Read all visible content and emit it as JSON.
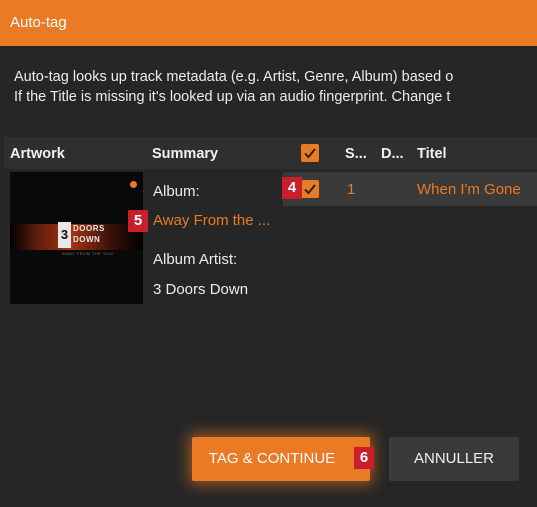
{
  "window": {
    "title": "Auto-tag"
  },
  "description": {
    "line1": "Auto-tag looks up track metadata (e.g. Artist, Genre, Album) based o",
    "line2": "If the Title is missing it's looked up via an audio fingerprint. Change t"
  },
  "table": {
    "headers": {
      "artwork": "Artwork",
      "summary": "Summary",
      "s": "S...",
      "d": "D...",
      "title": "Titel"
    },
    "header_checkbox_checked": true
  },
  "summary": {
    "album_label": "Album:",
    "album_value": "Away From the ...",
    "album_artist_label": "Album Artist:",
    "album_artist_value": "3 Doors Down"
  },
  "artwork": {
    "digit": "3",
    "line1": "DOORS",
    "line2": "DOWN",
    "subtitle": "AWAY FROM THE SUN"
  },
  "tracks": [
    {
      "checked": true,
      "number": "1",
      "title": "When I'm Gone"
    }
  ],
  "badges": {
    "track_checkbox": "4",
    "album_value": "5",
    "tag_button": "6"
  },
  "buttons": {
    "tag_continue": "TAG & CONTINUE",
    "cancel": "ANNULLER"
  },
  "colors": {
    "accent": "#ea7a24",
    "background": "#262626",
    "badge": "#c81f2a"
  }
}
